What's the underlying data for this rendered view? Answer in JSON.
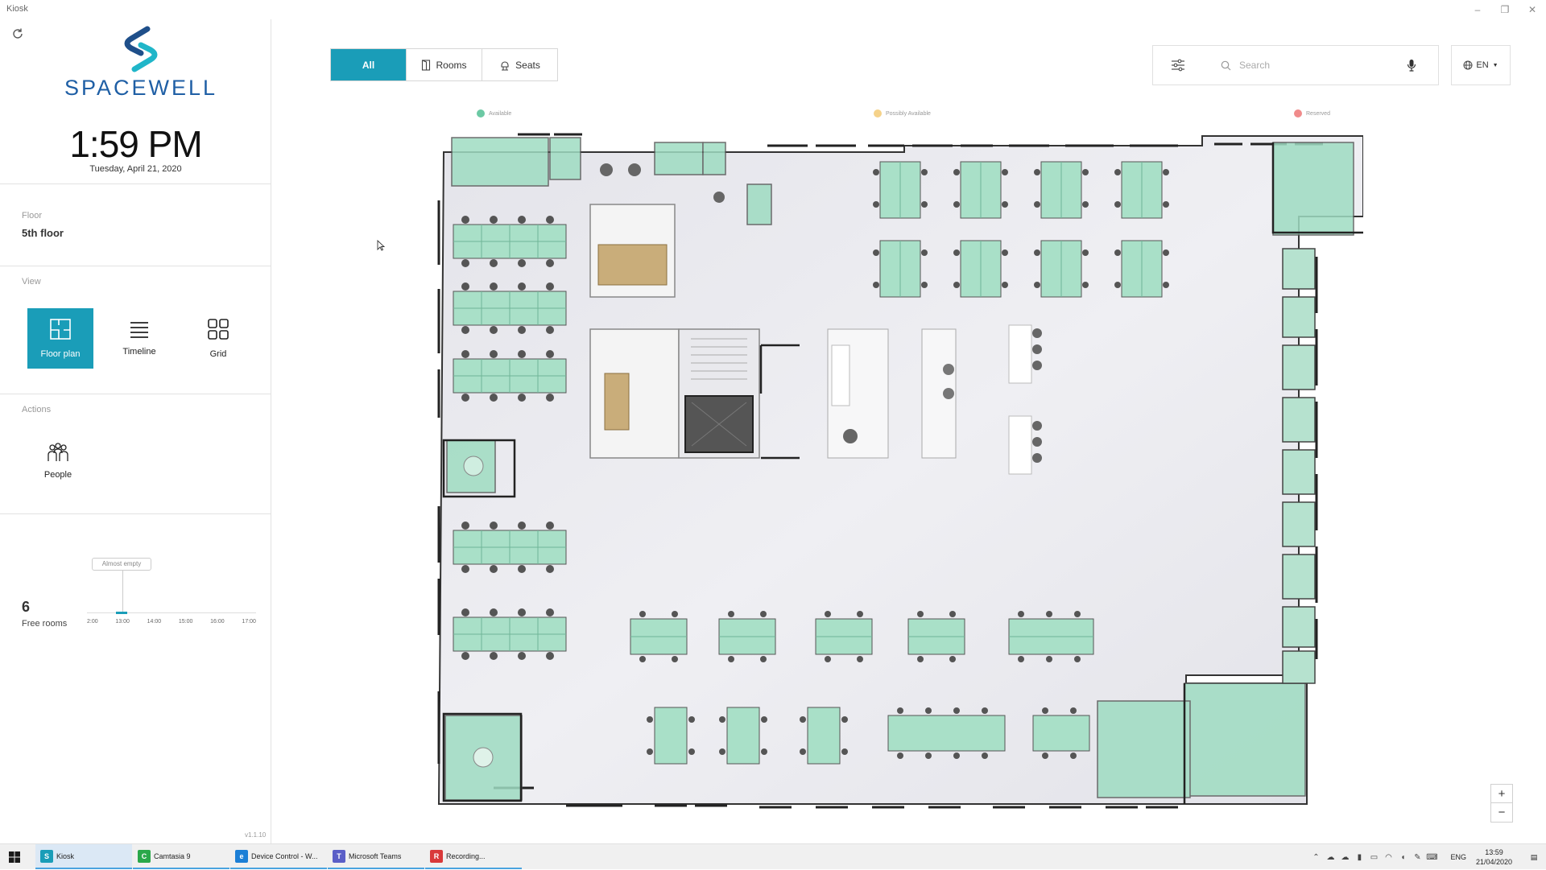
{
  "window": {
    "title": "Kiosk"
  },
  "brand": {
    "name": "SPACEWELL"
  },
  "clock": {
    "time": "1:59 PM",
    "date": "Tuesday, April 21, 2020"
  },
  "floor": {
    "label": "Floor",
    "value": "5th floor"
  },
  "view": {
    "label": "View",
    "options": [
      {
        "label": "Floor plan",
        "active": true
      },
      {
        "label": "Timeline",
        "active": false
      },
      {
        "label": "Grid",
        "active": false
      }
    ]
  },
  "actions": {
    "label": "Actions",
    "people_label": "People"
  },
  "stats": {
    "free_rooms_count": "6",
    "free_rooms_label": "Free rooms",
    "chart_tooltip": "Almost empty",
    "chart_ticks": [
      "2:00",
      "13:00",
      "14:00",
      "15:00",
      "16:00",
      "17:00"
    ]
  },
  "version": "v1.1.10",
  "toolbar": {
    "tabs": [
      {
        "label": "All",
        "active": true
      },
      {
        "label": "Rooms",
        "active": false
      },
      {
        "label": "Seats",
        "active": false
      }
    ],
    "search_placeholder": "Search",
    "language": "EN"
  },
  "legend": [
    {
      "label": "Available",
      "color": "#6cc9a4"
    },
    {
      "label": "Possibly Available",
      "color": "#f5d28a"
    },
    {
      "label": "Reserved",
      "color": "#f08b8b"
    }
  ],
  "zoom": {
    "in": "+",
    "out": "−"
  },
  "taskbar": {
    "items": [
      {
        "label": "Kiosk",
        "color": "#1a9db8",
        "active": true
      },
      {
        "label": "Camtasia 9",
        "color": "#2aa84a",
        "active": false
      },
      {
        "label": "Device Control - W...",
        "color": "#1c7fd6",
        "active": false
      },
      {
        "label": "Microsoft Teams",
        "color": "#5b5fc7",
        "active": false
      },
      {
        "label": "Recording...",
        "color": "#d9393a",
        "active": false
      }
    ],
    "input_lang": "ENG",
    "time": "13:59",
    "date": "21/04/2020"
  }
}
